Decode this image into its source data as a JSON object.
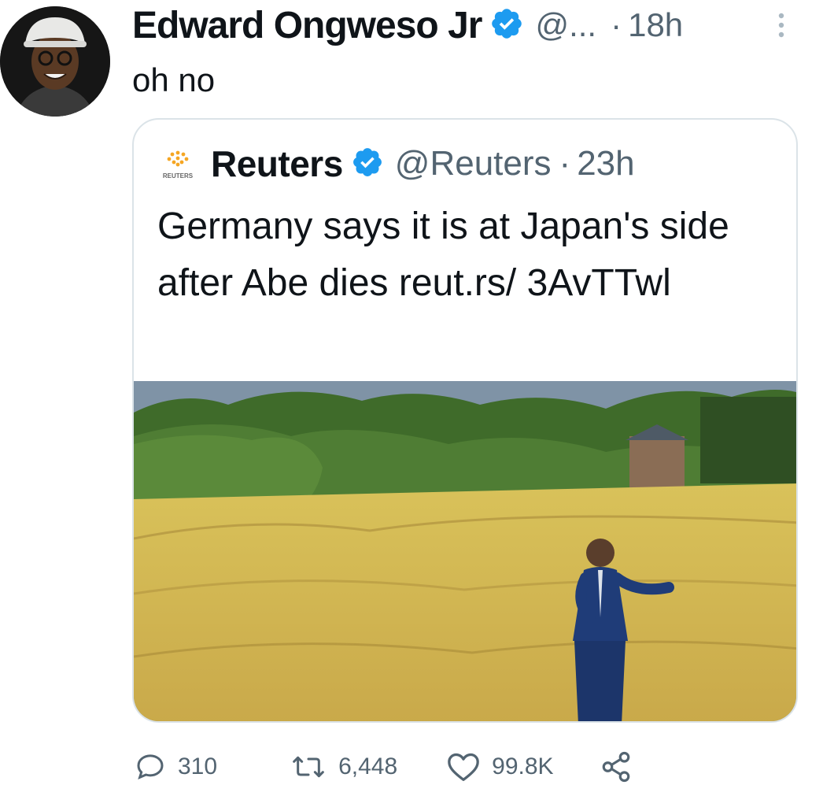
{
  "tweet": {
    "author_name": "Edward Ongweso Jr",
    "handle": "@...",
    "separator": "·",
    "time": "18h",
    "text": "oh no"
  },
  "quoted_tweet": {
    "logo_text": "REUTERS",
    "author_name": "Reuters",
    "handle": "@Reuters",
    "separator": "·",
    "time": "23h",
    "text": "Germany says it is at Japan's side after Abe dies reut.rs/ 3AvTTwl"
  },
  "actions": {
    "replies": "310",
    "retweets": "6,448",
    "likes": "99.8K"
  },
  "colors": {
    "verified": "#1d9bf0",
    "secondary_text": "#536471",
    "border": "#dbe3e8"
  },
  "icons": [
    "verified-badge-icon",
    "more-icon",
    "reply-icon",
    "retweet-icon",
    "like-icon",
    "share-icon"
  ]
}
